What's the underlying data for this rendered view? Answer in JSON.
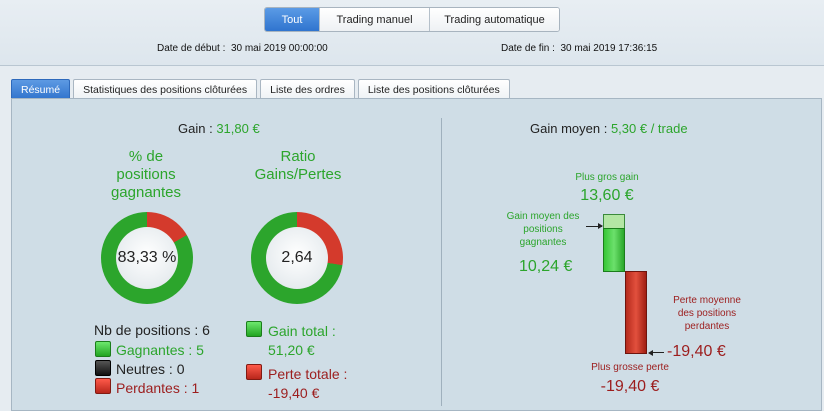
{
  "filters": {
    "buttons": [
      "Tout",
      "Trading manuel",
      "Trading automatique"
    ],
    "active": "Tout"
  },
  "dates": {
    "start_label": "Date de début :",
    "start_value": "30 mai 2019 00:00:00",
    "end_label": "Date de fin :",
    "end_value": "30 mai 2019 17:36:15"
  },
  "tabs": [
    "Résumé",
    "Statistiques des positions clôturées",
    "Liste des ordres",
    "Liste des positions clôturées"
  ],
  "summary": {
    "gain_label": "Gain",
    "gain_value": "31,80 €",
    "winpct_title": [
      "% de",
      "positions",
      "gagnantes"
    ],
    "winpct_value": "83,33 %",
    "winpct_fraction": 0.8333,
    "ratio_title": [
      "Ratio",
      "Gains/Pertes"
    ],
    "ratio_value": "2,64",
    "ratio_fraction": 0.725,
    "nb_positions_label": "Nb de positions : 6",
    "winners": "Gagnantes : 5",
    "neutral": "Neutres : 0",
    "losers": "Perdantes : 1",
    "gain_total_label": "Gain total :",
    "gain_total_value": "51,20 €",
    "perte_total_label": "Perte totale :",
    "perte_total_value": "-19,40 €"
  },
  "average": {
    "title_label": "Gain moyen",
    "title_value": "5,30 € / trade",
    "biggest_gain_label": "Plus gros gain",
    "biggest_gain_value": "13,60 €",
    "avg_win_label": [
      "Gain moyen des",
      "positions",
      "gagnantes"
    ],
    "avg_win_value": "10,24 €",
    "avg_loss_label": [
      "Perte moyenne",
      "des positions",
      "perdantes"
    ],
    "avg_loss_value": "-19,40 €",
    "biggest_loss_label": "Plus grosse perte",
    "biggest_loss_value": "-19,40 €"
  },
  "colors": {
    "gain": "#2ca52c",
    "loss": "#9c1d1d",
    "accent": "#3174cd"
  }
}
